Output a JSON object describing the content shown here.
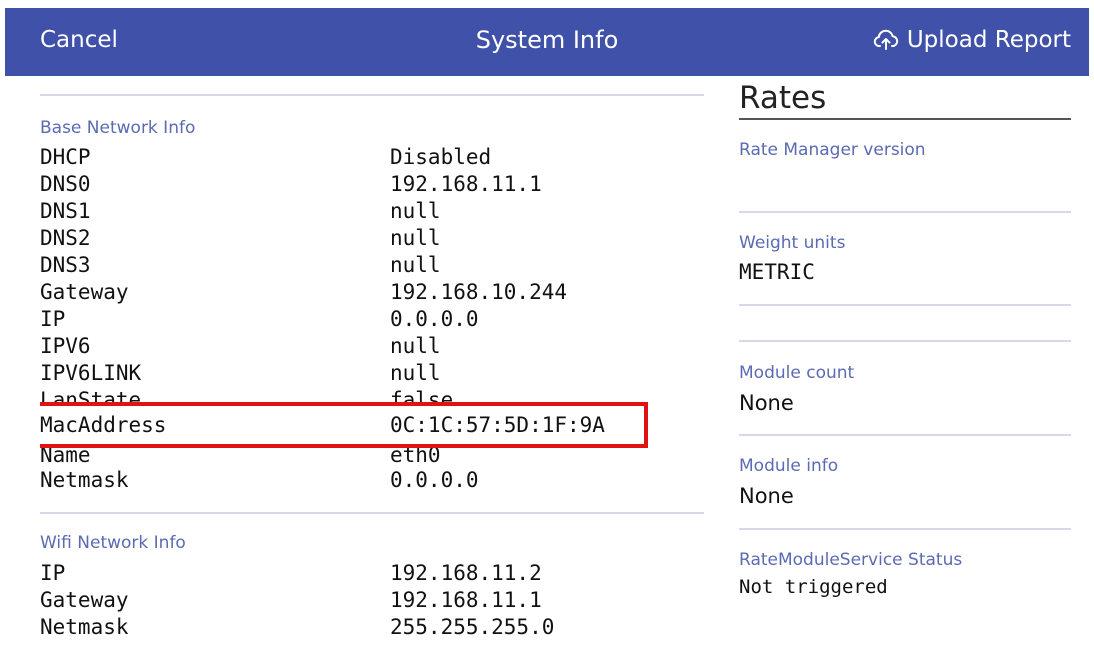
{
  "header": {
    "cancel_label": "Cancel",
    "title": "System Info",
    "upload_label": "Upload Report",
    "bg_color": "#3f51a8"
  },
  "base_network": {
    "label": "Base Network Info",
    "rows": [
      {
        "key": "DHCP",
        "value": "Disabled"
      },
      {
        "key": "DNS0",
        "value": "192.168.11.1"
      },
      {
        "key": "DNS1",
        "value": "null"
      },
      {
        "key": "DNS2",
        "value": "null"
      },
      {
        "key": "DNS3",
        "value": "null"
      },
      {
        "key": "Gateway",
        "value": "192.168.10.244"
      },
      {
        "key": "IP",
        "value": "0.0.0.0"
      },
      {
        "key": "IPV6",
        "value": "null"
      },
      {
        "key": "IPV6LINK",
        "value": "null"
      },
      {
        "key": "LanState",
        "value": "false"
      },
      {
        "key": "MacAddress",
        "value": "0C:1C:57:5D:1F:9A"
      },
      {
        "key": "Name",
        "value": "eth0"
      },
      {
        "key": "Netmask",
        "value": "0.0.0.0"
      }
    ]
  },
  "wifi_network": {
    "label": "Wifi Network Info",
    "rows": [
      {
        "key": "IP",
        "value": "192.168.11.2"
      },
      {
        "key": "Gateway",
        "value": "192.168.11.1"
      },
      {
        "key": "Netmask",
        "value": "255.255.255.0"
      }
    ]
  },
  "rates": {
    "title": "Rates",
    "rate_manager_label": "Rate Manager version",
    "weight_units_label": "Weight units",
    "weight_units_value": "METRIC",
    "module_count_label": "Module count",
    "module_count_value": "None",
    "module_info_label": "Module info",
    "module_info_value": "None",
    "service_status_label": "RateModuleService Status",
    "service_status_value": "Not triggered"
  },
  "highlight_color": "#e11212"
}
